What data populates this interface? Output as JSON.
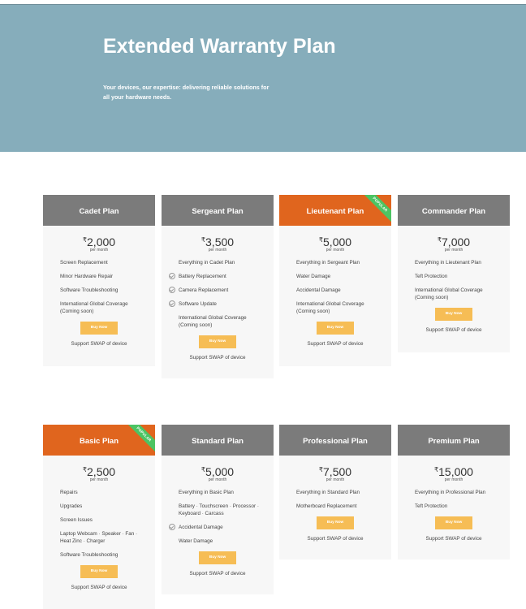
{
  "hero": {
    "title": "Extended Warranty Plan",
    "subtitle": "Your devices, our expertise: delivering reliable solutions for all your hardware needs."
  },
  "common": {
    "currency": "₹",
    "per_month": "per month",
    "buy_label": "Buy Now",
    "support": "Support SWAP of device",
    "badge": "POPULAR"
  },
  "plans": [
    {
      "name": "Cadet Plan",
      "price": "2,000",
      "features": [
        "Screen Replacement",
        "Minor Hardware Repair",
        "Software Troubleshooting",
        "International Global Coverage (Coming soon)"
      ]
    },
    {
      "name": "Sergeant Plan",
      "price": "3,500",
      "features": [
        "Everything in Cadet Plan",
        "Battery Replacement",
        "Camera Replacement",
        "Software Update",
        "International Global Coverage (Coming soon)"
      ]
    },
    {
      "name": "Lieutenant Plan",
      "price": "5,000",
      "features": [
        "Everything in Sergeant Plan",
        "Water Damage",
        "Accidental Damage",
        "International Global Coverage (Coming soon)"
      ]
    },
    {
      "name": "Commander Plan",
      "price": "7,000",
      "features": [
        "Everything in Lieutenant Plan",
        "Teft Protection",
        "International Global Coverage (Coming soon)"
      ]
    },
    {
      "name": "Basic Plan",
      "price": "2,500",
      "features": [
        "Repairs",
        "Upgrades",
        "Screen Issues",
        "Laptop Webcam · Speaker · Fan · Heat Zinc · Charger",
        "Software Troubleshooting"
      ]
    },
    {
      "name": "Standard Plan",
      "price": "5,000",
      "features": [
        "Everything in Basic Plan",
        "Battery · Touchscreen · Processor · Keyboard · Carcass",
        "Accidental Damage",
        "Water Damage"
      ]
    },
    {
      "name": "Professional Plan",
      "price": "7,500",
      "features": [
        "Everything in Standard Plan",
        "Motherboard Replacement"
      ]
    },
    {
      "name": "Premium Plan",
      "price": "15,000",
      "features": [
        "Everything in Professional Plan",
        "Teft Protection"
      ]
    }
  ]
}
